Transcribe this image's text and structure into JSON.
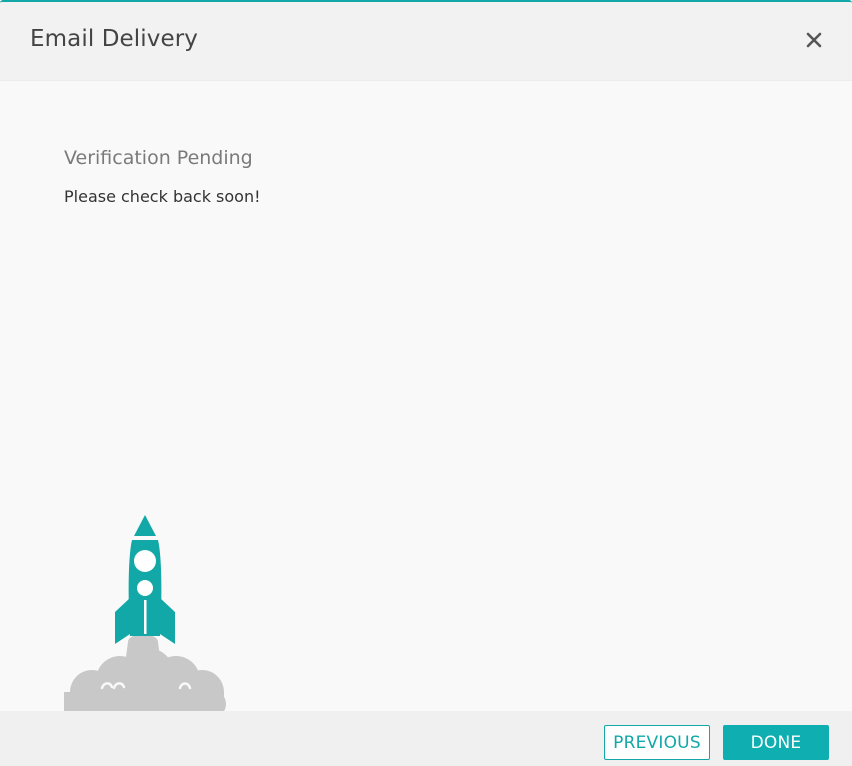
{
  "dialog": {
    "title": "Email Delivery",
    "close_icon": "close-icon"
  },
  "content": {
    "heading": "Verification Pending",
    "message": "Please check back soon!",
    "illustration": "rocket-launch-illustration"
  },
  "footer": {
    "previous_label": "PREVIOUS",
    "done_label": "DONE"
  },
  "colors": {
    "accent": "#13a8a8",
    "smoke": "#c8c8c8",
    "header_bg": "#f2f2f2",
    "body_bg": "#f9f9f9"
  }
}
